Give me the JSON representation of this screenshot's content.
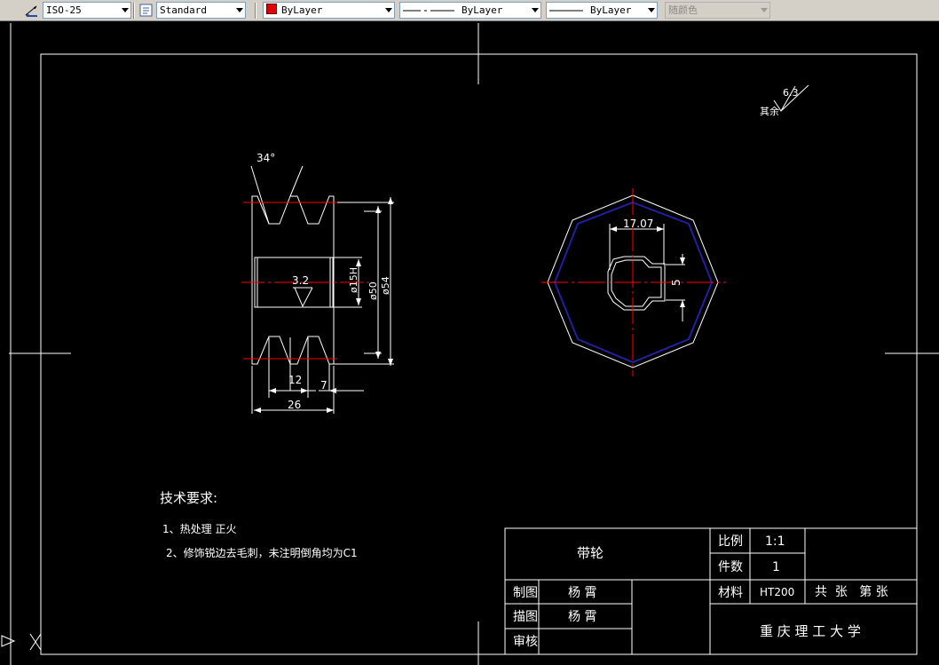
{
  "toolbar": {
    "dimstyle": "ISO-25",
    "textstyle": "Standard",
    "color": "ByLayer",
    "linetype": "ByLayer",
    "lineweight": "ByLayer",
    "plotstyle": "随颜色"
  },
  "drawing": {
    "angle": "34°",
    "rough_inner": "3.2",
    "dia_bore": "ø15H",
    "dia_50": "ø50",
    "dia_54": "ø54",
    "dim_12": "12",
    "dim_7": "7",
    "dim_26": "26",
    "key_width": "17.07",
    "key_depth": "5",
    "rough_value": "6.3",
    "rough_rest": "其余",
    "req_title": "技术要求:",
    "req_1": "1、热处理 正火",
    "req_2": "2、修饰锐边去毛刺，未注明倒角均为C1"
  },
  "title_block": {
    "part_name": "带轮",
    "scale_label": "比例",
    "scale_value": "1:1",
    "qty_label": "件数",
    "qty_value": "1",
    "material_label": "材料",
    "material_value": "HT200",
    "sheets": "共  张   第 张",
    "drawn_label": "制图",
    "drawn_name": "杨 霄",
    "traced_label": "描图",
    "traced_name": "杨 霄",
    "check_label": "审核",
    "school": "重 庆 理 工 大 学"
  },
  "colors": {
    "canvas": "#000000",
    "line": "#ffffff",
    "center": "#ff0000",
    "hidden": "#2020a0",
    "toolbar": "#d4d0c8"
  }
}
